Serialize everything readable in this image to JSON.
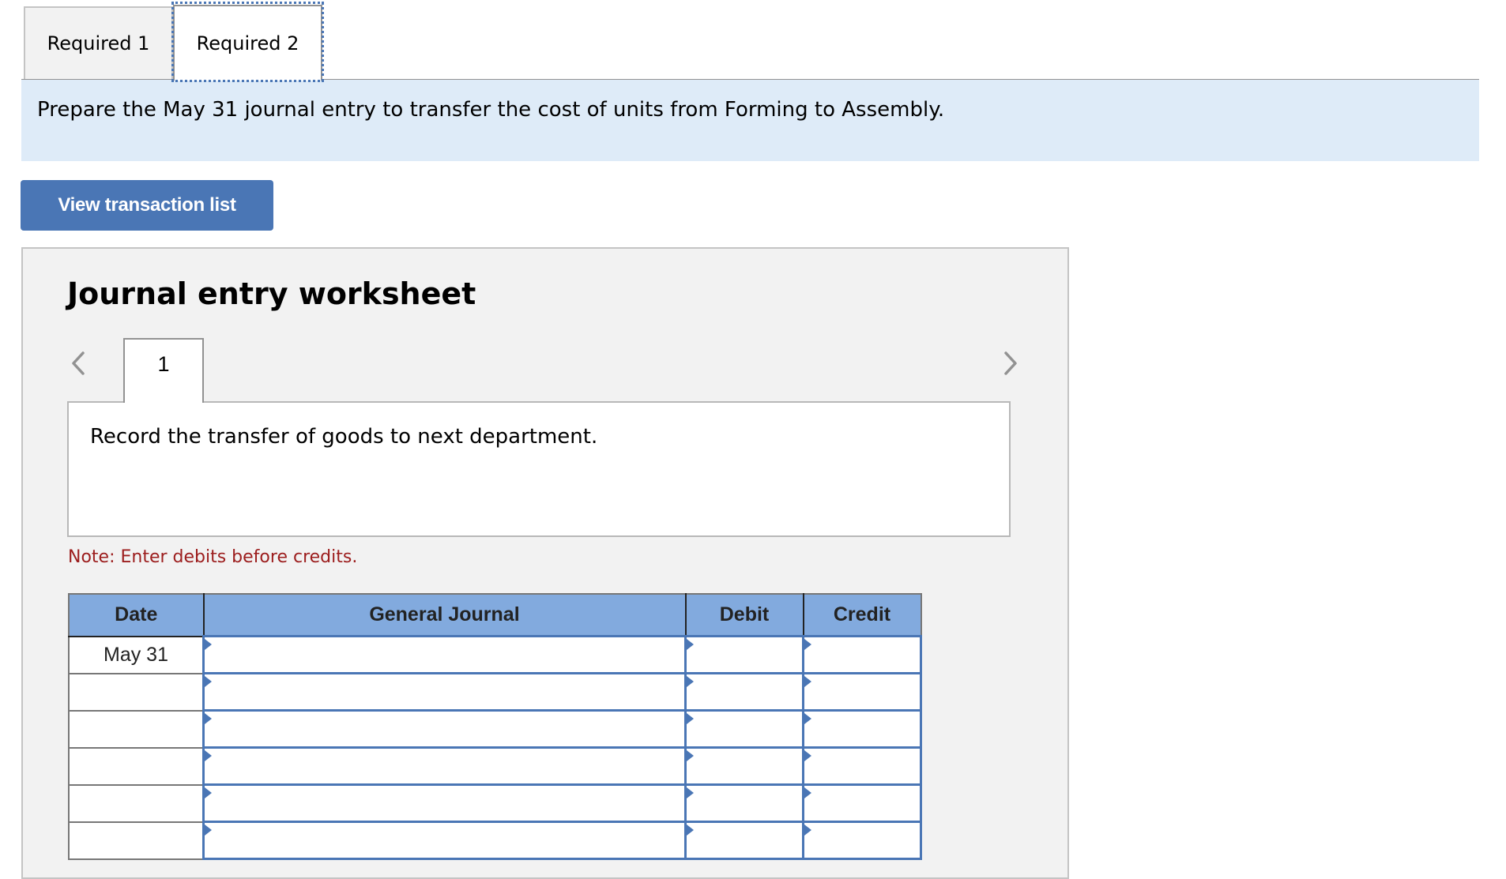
{
  "tabs": [
    {
      "label": "Required 1",
      "active": false
    },
    {
      "label": "Required 2",
      "active": true
    }
  ],
  "prompt": "Prepare the May 31 journal entry to transfer the cost of units from Forming to Assembly.",
  "view_transaction_button": "View transaction list",
  "worksheet": {
    "title": "Journal entry worksheet",
    "prev_icon": "chevron-left-icon",
    "next_icon": "chevron-right-icon",
    "page_tab": "1",
    "instruction": "Record the transfer of goods to next department.",
    "note": "Note: Enter debits before credits.",
    "table": {
      "headers": [
        "Date",
        "General Journal",
        "Debit",
        "Credit"
      ],
      "rows": [
        {
          "date": "May 31",
          "account": "",
          "debit": "",
          "credit": ""
        },
        {
          "date": "",
          "account": "",
          "debit": "",
          "credit": ""
        },
        {
          "date": "",
          "account": "",
          "debit": "",
          "credit": ""
        },
        {
          "date": "",
          "account": "",
          "debit": "",
          "credit": ""
        },
        {
          "date": "",
          "account": "",
          "debit": "",
          "credit": ""
        },
        {
          "date": "",
          "account": "",
          "debit": "",
          "credit": ""
        }
      ]
    }
  },
  "colors": {
    "button": "#4a76b5",
    "prompt_bg": "#deebf8",
    "header_bg": "#82aade",
    "note_text": "#9c1d1d"
  }
}
